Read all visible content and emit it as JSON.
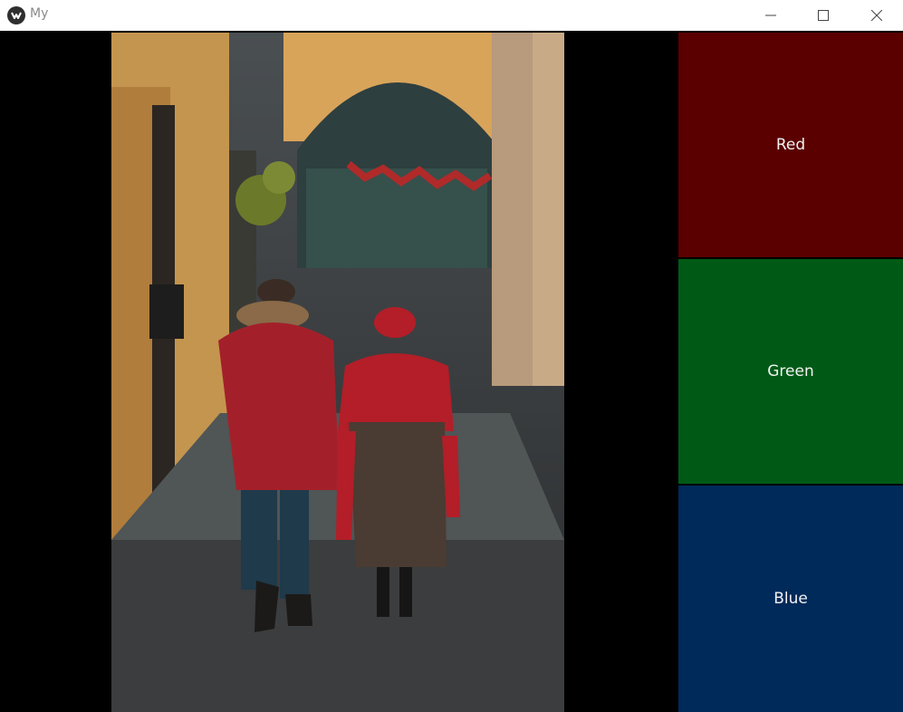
{
  "window": {
    "title": "My",
    "icon": "kivy-logo-icon",
    "controls": [
      "minimize-icon",
      "maximize-icon",
      "close-icon"
    ]
  },
  "image": {
    "subject": "photo"
  },
  "buttons": [
    {
      "label": "Red",
      "color": "#5a0000"
    },
    {
      "label": "Green",
      "color": "#005a16"
    },
    {
      "label": "Blue",
      "color": "#002a5a"
    }
  ]
}
